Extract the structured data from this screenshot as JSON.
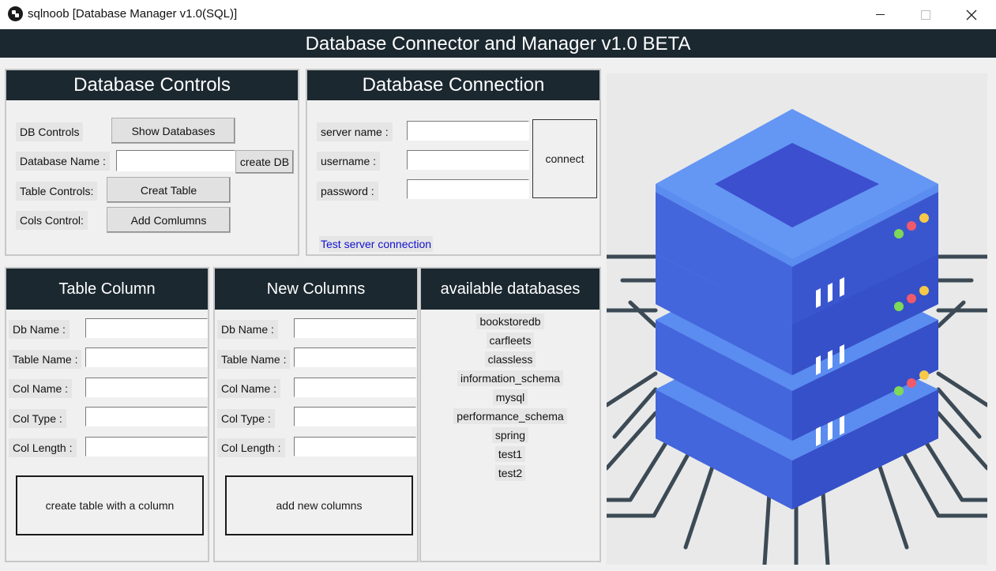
{
  "window": {
    "title": "sqlnoob [Database Manager v1.0(SQL)]",
    "icon": "app-logo-icon",
    "controls": {
      "minimize": "minimize-icon",
      "maximize": "maximize-icon",
      "close": "close-icon"
    }
  },
  "banner": {
    "title": "Database Connector and Manager v1.0 BETA"
  },
  "db_controls": {
    "heading": "Database Controls",
    "db_controls_label": "DB Controls",
    "show_databases_button": "Show Databases",
    "database_name_label": "Database Name :",
    "database_name_value": "",
    "create_db_button": "create DB",
    "table_controls_label": "Table Controls:",
    "create_table_button": "Creat Table",
    "cols_control_label": "Cols Control:",
    "add_columns_button": "Add Comlumns"
  },
  "db_connection": {
    "heading": "Database Connection",
    "server_name_label": "server name :",
    "server_name_value": "",
    "username_label": "username :",
    "username_value": "",
    "password_label": "password :",
    "password_value": "",
    "connect_button": "connect",
    "test_link": "Test server connection"
  },
  "table_column": {
    "heading": "Table Column",
    "fields": [
      {
        "label": "Db Name :",
        "value": ""
      },
      {
        "label": "Table Name :",
        "value": ""
      },
      {
        "label": "Col Name :",
        "value": ""
      },
      {
        "label": "Col Type :",
        "value": ""
      },
      {
        "label": "Col Length :",
        "value": ""
      }
    ],
    "action_button": "create table with a column"
  },
  "new_columns": {
    "heading": "New Columns",
    "fields": [
      {
        "label": "Db Name :",
        "value": ""
      },
      {
        "label": "Table Name :",
        "value": ""
      },
      {
        "label": "Col Name :",
        "value": ""
      },
      {
        "label": "Col Type :",
        "value": ""
      },
      {
        "label": "Col Length :",
        "value": ""
      }
    ],
    "action_button": "add new columns"
  },
  "available_databases": {
    "heading": "available databases",
    "items": [
      "bookstoredb",
      "carfleets",
      "classless",
      "information_schema",
      "mysql",
      "performance_schema",
      "spring",
      "test1",
      "test2"
    ]
  },
  "illustration": {
    "icon": "database-server-icon",
    "colors": {
      "server_blue": "#4f7fe6",
      "server_dark": "#3552c9",
      "circuit": "#3c4a55",
      "led_green": "#7ed957",
      "led_red": "#f05a6a",
      "led_yellow": "#f7c948"
    }
  }
}
